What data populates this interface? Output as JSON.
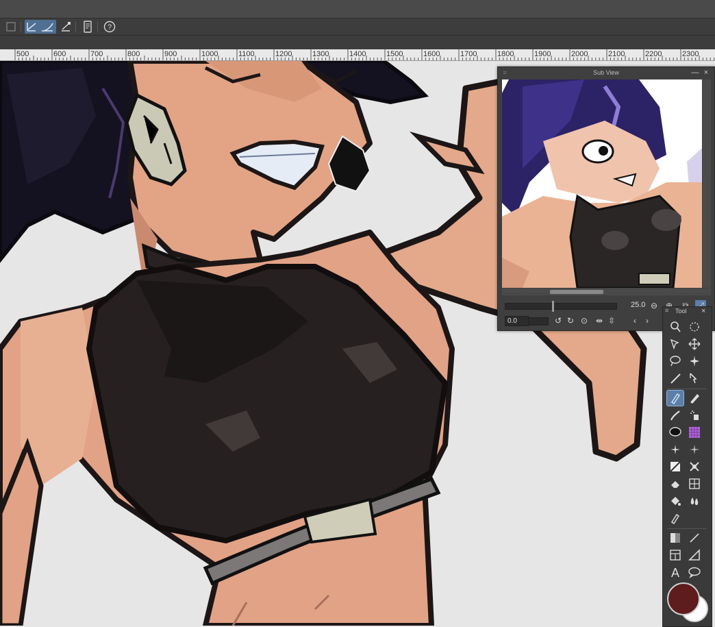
{
  "ruler": {
    "labels": [
      "500",
      "600",
      "700",
      "800",
      "900",
      "1000",
      "1100",
      "1200",
      "1300",
      "1400",
      "1500",
      "1600",
      "1700",
      "1800",
      "1900",
      "2000",
      "2100",
      "2200",
      "2300"
    ]
  },
  "toolbar": {
    "icons": [
      "layer-icon",
      "correct-line-icon",
      "stabilization-icon",
      "ruler-tool-icon",
      "tablet-icon",
      "help-icon"
    ]
  },
  "subview": {
    "title": "Sub View",
    "zoom_value": "25.0",
    "rotation_value": "0.0",
    "close_glyph": "×",
    "minimize_glyph": "—"
  },
  "toolpanel": {
    "title": "Tool",
    "close_glyph": "×",
    "main_color": "#5e1c1c",
    "sub_color": "#ffffff",
    "accent": "#5b7fa6"
  }
}
